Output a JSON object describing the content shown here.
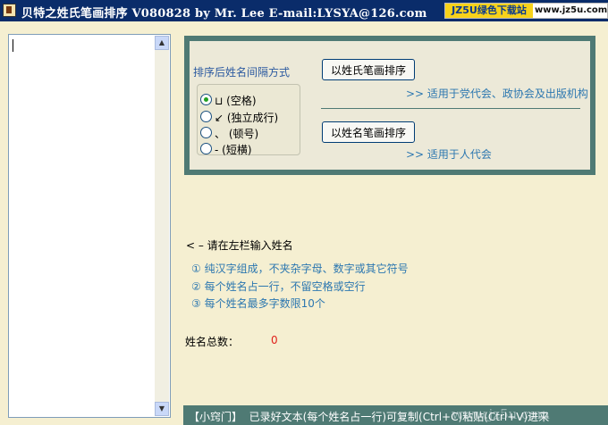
{
  "window": {
    "title": "贝特之姓氏笔画排序  V080828  by Mr. Lee  E-mail:LYSYA@126.com",
    "app_icon": "app-icon"
  },
  "badge": {
    "brand": "JZ5U绿色下载站",
    "url": "www.jz5u.com"
  },
  "name_input": {
    "value": ""
  },
  "options": {
    "group_label": "排序后姓名间隔方式",
    "radios": [
      {
        "label": "⊔ (空格)",
        "selected": true
      },
      {
        "label": "↙ (独立成行)",
        "selected": false
      },
      {
        "label": "、 (顿号)",
        "selected": false
      },
      {
        "label": "- (短横)",
        "selected": false
      }
    ],
    "sort_surname_button": "以姓氏笔画排序",
    "sort_surname_hint": ">> 适用于党代会、政协会及出版机构",
    "sort_name_button": "以姓名笔画排序",
    "sort_name_hint": ">> 适用于人代会"
  },
  "instructions": {
    "prompt": "< – 请在左栏输入姓名",
    "rules": [
      "① 纯汉字组成，不夹杂字母、数字或其它符号",
      "② 每个姓名占一行，不留空格或空行",
      "③ 每个姓名最多字数限10个"
    ]
  },
  "count": {
    "label": "姓名总数：",
    "value": "0"
  },
  "footer": {
    "tag": "【小窍门】",
    "tip": "已录好文本(每个姓名占一行)可复制(Ctrl+C)粘贴(Ctrl+V)进来",
    "watermark": "www.jz5u.com"
  },
  "colors": {
    "panel_border": "#4f7a74",
    "hint_text": "#2c77b0",
    "count_value": "#e0201a",
    "background": "#f5efd1"
  }
}
